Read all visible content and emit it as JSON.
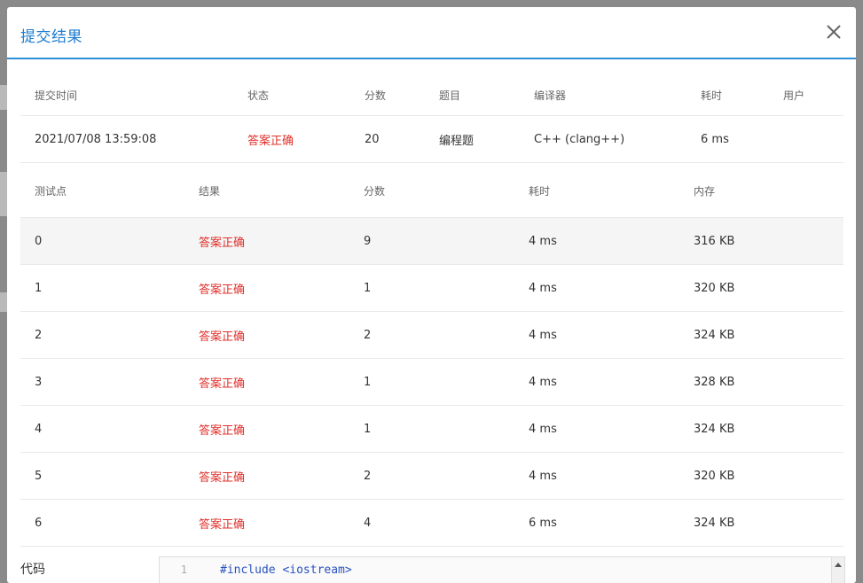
{
  "modal": {
    "title": "提交结果"
  },
  "summary": {
    "headers": [
      "提交时间",
      "状态",
      "分数",
      "题目",
      "编译器",
      "耗时",
      "用户"
    ],
    "row": [
      "2021/07/08 13:59:08",
      "答案正确",
      "20",
      "编程题",
      "C++ (clang++)",
      "6 ms",
      ""
    ]
  },
  "cases": {
    "headers": [
      "测试点",
      "结果",
      "分数",
      "耗时",
      "内存"
    ],
    "rows": [
      [
        "0",
        "答案正确",
        "9",
        "4 ms",
        "316 KB"
      ],
      [
        "1",
        "答案正确",
        "1",
        "4 ms",
        "320 KB"
      ],
      [
        "2",
        "答案正确",
        "2",
        "4 ms",
        "324 KB"
      ],
      [
        "3",
        "答案正确",
        "1",
        "4 ms",
        "328 KB"
      ],
      [
        "4",
        "答案正确",
        "1",
        "4 ms",
        "324 KB"
      ],
      [
        "5",
        "答案正确",
        "2",
        "4 ms",
        "320 KB"
      ],
      [
        "6",
        "答案正确",
        "4",
        "6 ms",
        "324 KB"
      ]
    ]
  },
  "code": {
    "label": "代码",
    "line_number": "1",
    "first_line": "#include <iostream>"
  },
  "colors": {
    "accent": "#1f7dd0",
    "status_ok": "#e0312c"
  },
  "icons": {
    "close": "close-icon"
  }
}
